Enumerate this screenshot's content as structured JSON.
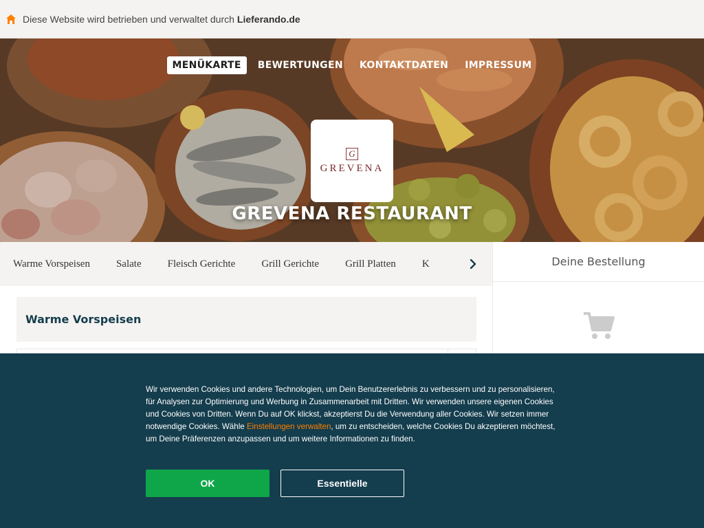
{
  "topbar": {
    "text": "Diese Website wird betrieben und verwaltet durch",
    "brand": "Lieferando.de",
    "icon": "home-icon",
    "icon_color": "#ff8000"
  },
  "nav": {
    "items": [
      {
        "label": "MENÜKARTE",
        "active": true
      },
      {
        "label": "BEWERTUNGEN",
        "active": false
      },
      {
        "label": "KONTAKTDATEN",
        "active": false
      },
      {
        "label": "IMPRESSUM",
        "active": false
      }
    ]
  },
  "restaurant": {
    "logo_monogram": "G",
    "logo_text": "GREVENA",
    "title": "GREVENA RESTAURANT"
  },
  "categories": {
    "items": [
      "Warme Vorspeisen",
      "Salate",
      "Fleisch Gerichte",
      "Grill Gerichte",
      "Grill Platten",
      "K"
    ],
    "next_icon": "chevron-right-icon"
  },
  "menu": {
    "section_title": "Warme Vorspeisen"
  },
  "basket": {
    "title": "Deine Bestellung",
    "icon": "shopping-cart-icon",
    "icon_color": "#cccccc"
  },
  "cookie": {
    "text_before_link": "Wir verwenden Cookies und andere Technologien, um Dein Benutzererlebnis zu verbessern und zu personalisieren, für Analysen zur Optimierung und Werbung in Zusammenarbeit mit Dritten. Wir verwenden unsere eigenen Cookies und Cookies von Dritten. Wenn Du auf OK klickst, akzeptierst Du die Verwendung aller Cookies. Wir setzen immer notwendige Cookies. Wähle ",
    "link": "Einstellungen verwalten",
    "text_after_link": ", um zu entscheiden, welche Cookies Du akzeptieren möchtest, um Deine Präferenzen anzupassen und um weitere Informationen zu finden.",
    "ok_label": "OK",
    "essential_label": "Essentielle",
    "background_color": "#143d4d",
    "ok_color": "#0fa64a",
    "link_color": "#ff8000"
  }
}
